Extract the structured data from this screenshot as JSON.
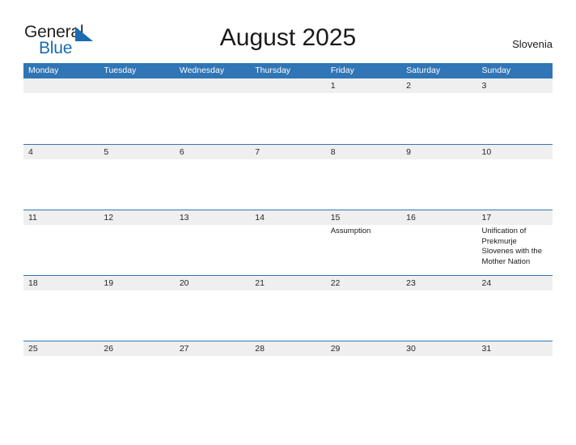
{
  "logo": {
    "word_one": "General",
    "word_two": "Blue",
    "mark_icon": "triangle-flag-icon",
    "accent_color": "#1b6cb0"
  },
  "header": {
    "title": "August 2025",
    "country": "Slovenia"
  },
  "theme": {
    "header_blue": "#3075b5",
    "band_gray": "#efefef",
    "text_dark": "#262626",
    "page_background": "#ffffff"
  },
  "calendar": {
    "weekday_headers": [
      "Monday",
      "Tuesday",
      "Wednesday",
      "Thursday",
      "Friday",
      "Saturday",
      "Sunday"
    ],
    "weeks": [
      {
        "days": [
          {
            "number": "",
            "event": ""
          },
          {
            "number": "",
            "event": ""
          },
          {
            "number": "",
            "event": ""
          },
          {
            "number": "",
            "event": ""
          },
          {
            "number": "1",
            "event": ""
          },
          {
            "number": "2",
            "event": ""
          },
          {
            "number": "3",
            "event": ""
          }
        ]
      },
      {
        "days": [
          {
            "number": "4",
            "event": ""
          },
          {
            "number": "5",
            "event": ""
          },
          {
            "number": "6",
            "event": ""
          },
          {
            "number": "7",
            "event": ""
          },
          {
            "number": "8",
            "event": ""
          },
          {
            "number": "9",
            "event": ""
          },
          {
            "number": "10",
            "event": ""
          }
        ]
      },
      {
        "days": [
          {
            "number": "11",
            "event": ""
          },
          {
            "number": "12",
            "event": ""
          },
          {
            "number": "13",
            "event": ""
          },
          {
            "number": "14",
            "event": ""
          },
          {
            "number": "15",
            "event": "Assumption"
          },
          {
            "number": "16",
            "event": ""
          },
          {
            "number": "17",
            "event": "Unification of Prekmurje Slovenes with the Mother Nation"
          }
        ]
      },
      {
        "days": [
          {
            "number": "18",
            "event": ""
          },
          {
            "number": "19",
            "event": ""
          },
          {
            "number": "20",
            "event": ""
          },
          {
            "number": "21",
            "event": ""
          },
          {
            "number": "22",
            "event": ""
          },
          {
            "number": "23",
            "event": ""
          },
          {
            "number": "24",
            "event": ""
          }
        ]
      },
      {
        "days": [
          {
            "number": "25",
            "event": ""
          },
          {
            "number": "26",
            "event": ""
          },
          {
            "number": "27",
            "event": ""
          },
          {
            "number": "28",
            "event": ""
          },
          {
            "number": "29",
            "event": ""
          },
          {
            "number": "30",
            "event": ""
          },
          {
            "number": "31",
            "event": ""
          }
        ]
      }
    ]
  }
}
